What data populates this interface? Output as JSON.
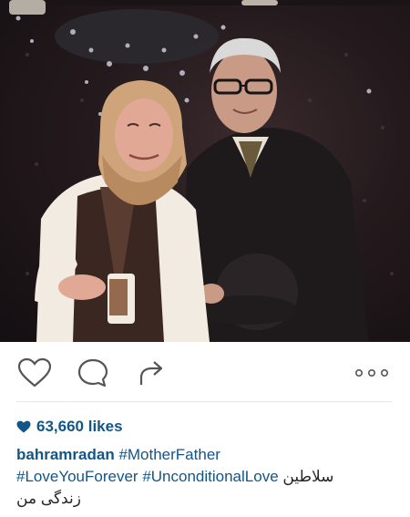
{
  "post": {
    "photo": {
      "description_icon": "photo-couple"
    },
    "actions": {
      "like_icon": "heart-outline-icon",
      "comment_icon": "speech-bubble-icon",
      "share_icon": "share-arrow-icon",
      "more_icon": "more-dots-icon"
    },
    "likes": {
      "count_text": "63,660 likes",
      "color": "#125688"
    },
    "caption": {
      "username": "bahramradan",
      "tag1": "#MotherFather",
      "tag2": "#LoveYouForever",
      "tag3": "#UnconditionalLove",
      "persian_1": "سلاطین",
      "persian_2": "زندگی من"
    }
  }
}
